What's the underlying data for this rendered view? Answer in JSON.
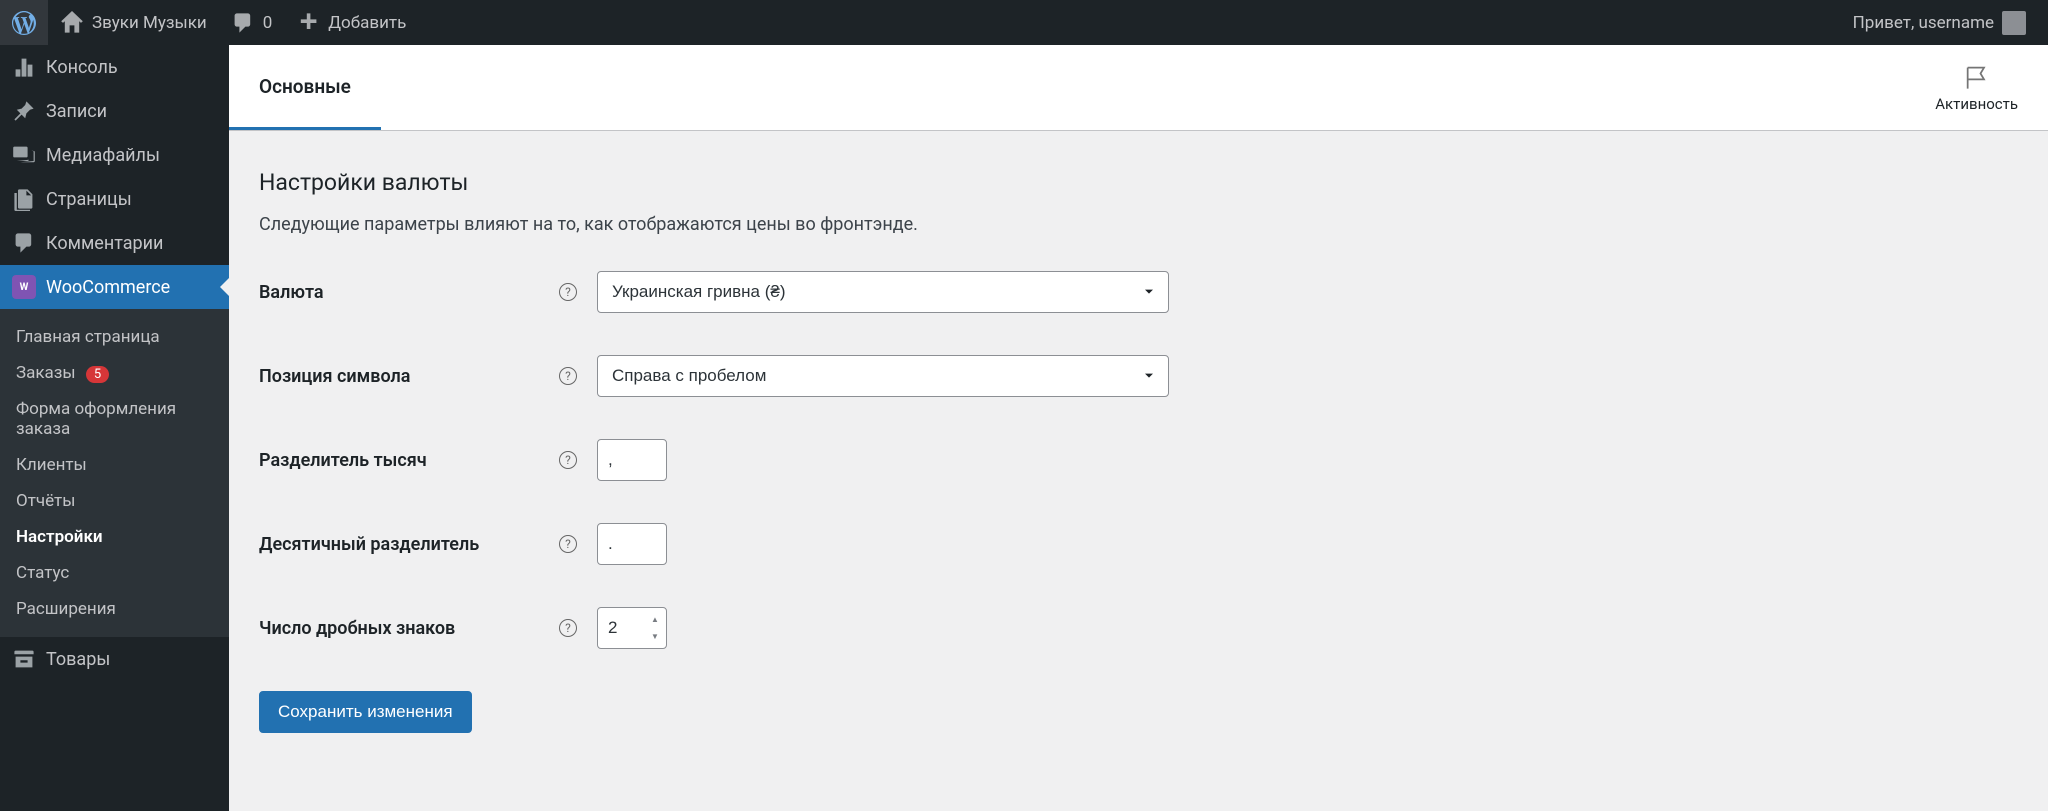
{
  "adminbar": {
    "site_name": "Звуки Музыки",
    "comments_count": "0",
    "add_new": "Добавить",
    "howdy_prefix": "Привет, ",
    "username": "username"
  },
  "sidebar": {
    "items": [
      {
        "label": "Консоль",
        "icon": "dashboard"
      },
      {
        "label": "Записи",
        "icon": "pin"
      },
      {
        "label": "Медиафайлы",
        "icon": "media"
      },
      {
        "label": "Страницы",
        "icon": "page"
      },
      {
        "label": "Комментарии",
        "icon": "comment"
      },
      {
        "label": "WooCommerce",
        "icon": "woo",
        "current": true
      },
      {
        "label": "Товары",
        "icon": "archive"
      }
    ],
    "submenu": [
      {
        "label": "Главная страница"
      },
      {
        "label": "Заказы",
        "badge": "5"
      },
      {
        "label": "Форма оформления заказа"
      },
      {
        "label": "Клиенты"
      },
      {
        "label": "Отчёты"
      },
      {
        "label": "Настройки",
        "current": true
      },
      {
        "label": "Статус"
      },
      {
        "label": "Расширения"
      }
    ]
  },
  "tabs": {
    "main": "Основные",
    "activity": "Активность"
  },
  "section": {
    "title": "Настройки валюты",
    "desc": "Следующие параметры влияют на то, как отображаются цены во фронтэнде."
  },
  "fields": {
    "currency": {
      "label": "Валюта",
      "value": "Украинская гривна (₴)"
    },
    "position": {
      "label": "Позиция символа",
      "value": "Справа с пробелом"
    },
    "thousand": {
      "label": "Разделитель тысяч",
      "value": ","
    },
    "decimal": {
      "label": "Десятичный разделитель",
      "value": "."
    },
    "num_dec": {
      "label": "Число дробных знаков",
      "value": "2"
    }
  },
  "button": {
    "save": "Сохранить изменения"
  }
}
